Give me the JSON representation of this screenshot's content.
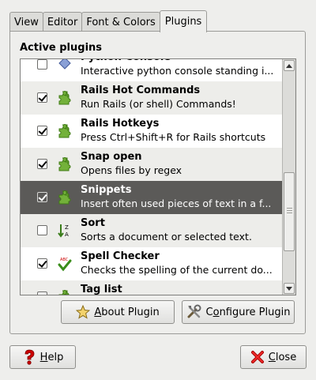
{
  "tabs": [
    {
      "label": "View",
      "active": false
    },
    {
      "label": "Editor",
      "active": false
    },
    {
      "label": "Font & Colors",
      "active": false
    },
    {
      "label": "Plugins",
      "active": true
    }
  ],
  "section_title": "Active plugins",
  "plugins": [
    {
      "name": "Python Console",
      "description": "Interactive python console standing i...",
      "checked": false,
      "icon": "python-console-icon",
      "selected": false
    },
    {
      "name": "Rails Hot Commands",
      "description": "Run Rails (or shell) Commands!",
      "checked": true,
      "icon": "puzzle-piece-icon",
      "selected": false
    },
    {
      "name": "Rails Hotkeys",
      "description": "Press Ctrl+Shift+R for Rails shortcuts",
      "checked": true,
      "icon": "puzzle-piece-icon",
      "selected": false
    },
    {
      "name": "Snap open",
      "description": "Opens files by regex",
      "checked": true,
      "icon": "puzzle-piece-icon",
      "selected": false
    },
    {
      "name": "Snippets",
      "description": "Insert often used pieces of text in a f...",
      "checked": true,
      "icon": "puzzle-piece-icon",
      "selected": true
    },
    {
      "name": "Sort",
      "description": "Sorts a document or selected text.",
      "checked": false,
      "icon": "sort-icon",
      "selected": false
    },
    {
      "name": "Spell Checker",
      "description": "Checks the spelling of the current do...",
      "checked": true,
      "icon": "spell-check-icon",
      "selected": false
    },
    {
      "name": "Tag list",
      "description": "",
      "checked": false,
      "icon": "puzzle-piece-icon",
      "selected": false
    }
  ],
  "buttons": {
    "about": {
      "mnemonic": "A",
      "rest": "bout Plugin"
    },
    "configure": {
      "pre": "C",
      "mnemonic": "o",
      "rest": "nfigure Plugin"
    },
    "help": {
      "mnemonic": "H",
      "rest": "elp"
    },
    "close": {
      "mnemonic": "C",
      "rest": "lose"
    }
  },
  "colors": {
    "selection_bg": "#5b5a58",
    "puzzle_green": "#73b13a",
    "help_red": "#cc0000"
  }
}
